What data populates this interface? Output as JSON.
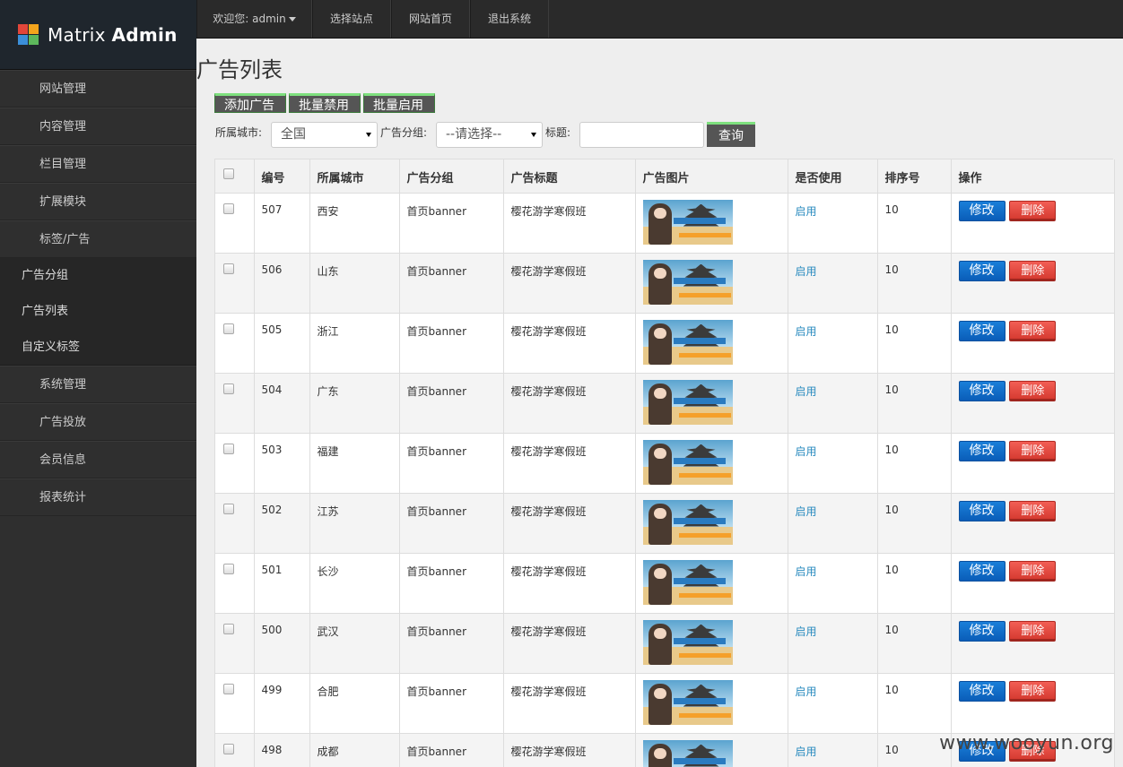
{
  "app": {
    "logo_matrix": "Matrix",
    "logo_admin": "Admin"
  },
  "topbar": {
    "welcome": "欢迎您: admin",
    "select_site": "选择站点",
    "site_home": "网站首页",
    "logout": "退出系统"
  },
  "sidebar": {
    "items": [
      {
        "label": "网站管理"
      },
      {
        "label": "内容管理"
      },
      {
        "label": "栏目管理"
      },
      {
        "label": "扩展模块"
      },
      {
        "label": "标签/广告"
      }
    ],
    "sub_items": [
      {
        "label": "广告分组"
      },
      {
        "label": "广告列表"
      },
      {
        "label": "自定义标签"
      }
    ],
    "items_after": [
      {
        "label": "系统管理"
      },
      {
        "label": "广告投放"
      },
      {
        "label": "会员信息"
      },
      {
        "label": "报表统计"
      }
    ]
  },
  "page": {
    "title": "广告列表"
  },
  "actions": {
    "add": "添加广告",
    "batch_disable": "批量禁用",
    "batch_enable": "批量启用"
  },
  "filters": {
    "city_label": "所属城市:",
    "city_value": "全国",
    "group_label": "广告分组:",
    "group_value": "--请选择--",
    "title_label": "标题:",
    "title_value": "",
    "query_button": "查询"
  },
  "table": {
    "headers": [
      "",
      "编号",
      "所属城市",
      "广告分组",
      "广告标题",
      "广告图片",
      "是否使用",
      "排序号",
      "操作"
    ],
    "edit_label": "修改",
    "delete_label": "删除",
    "rows": [
      {
        "id": "507",
        "city": "西安",
        "group": "首页banner",
        "title": "樱花游学寒假班",
        "status": "启用",
        "order": "10"
      },
      {
        "id": "506",
        "city": "山东",
        "group": "首页banner",
        "title": "樱花游学寒假班",
        "status": "启用",
        "order": "10"
      },
      {
        "id": "505",
        "city": "浙江",
        "group": "首页banner",
        "title": "樱花游学寒假班",
        "status": "启用",
        "order": "10"
      },
      {
        "id": "504",
        "city": "广东",
        "group": "首页banner",
        "title": "樱花游学寒假班",
        "status": "启用",
        "order": "10"
      },
      {
        "id": "503",
        "city": "福建",
        "group": "首页banner",
        "title": "樱花游学寒假班",
        "status": "启用",
        "order": "10"
      },
      {
        "id": "502",
        "city": "江苏",
        "group": "首页banner",
        "title": "樱花游学寒假班",
        "status": "启用",
        "order": "10"
      },
      {
        "id": "501",
        "city": "长沙",
        "group": "首页banner",
        "title": "樱花游学寒假班",
        "status": "启用",
        "order": "10"
      },
      {
        "id": "500",
        "city": "武汉",
        "group": "首页banner",
        "title": "樱花游学寒假班",
        "status": "启用",
        "order": "10"
      },
      {
        "id": "499",
        "city": "合肥",
        "group": "首页banner",
        "title": "樱花游学寒假班",
        "status": "启用",
        "order": "10"
      },
      {
        "id": "498",
        "city": "成都",
        "group": "首页banner",
        "title": "樱花游学寒假班",
        "status": "启用",
        "order": "10"
      }
    ]
  },
  "watermark": "www.wooyun.org",
  "colors": {
    "accent_blue": "#0a5db8",
    "danger_red": "#d63b31",
    "success_green": "#7ee07e",
    "status_link": "#2a8bbf"
  }
}
